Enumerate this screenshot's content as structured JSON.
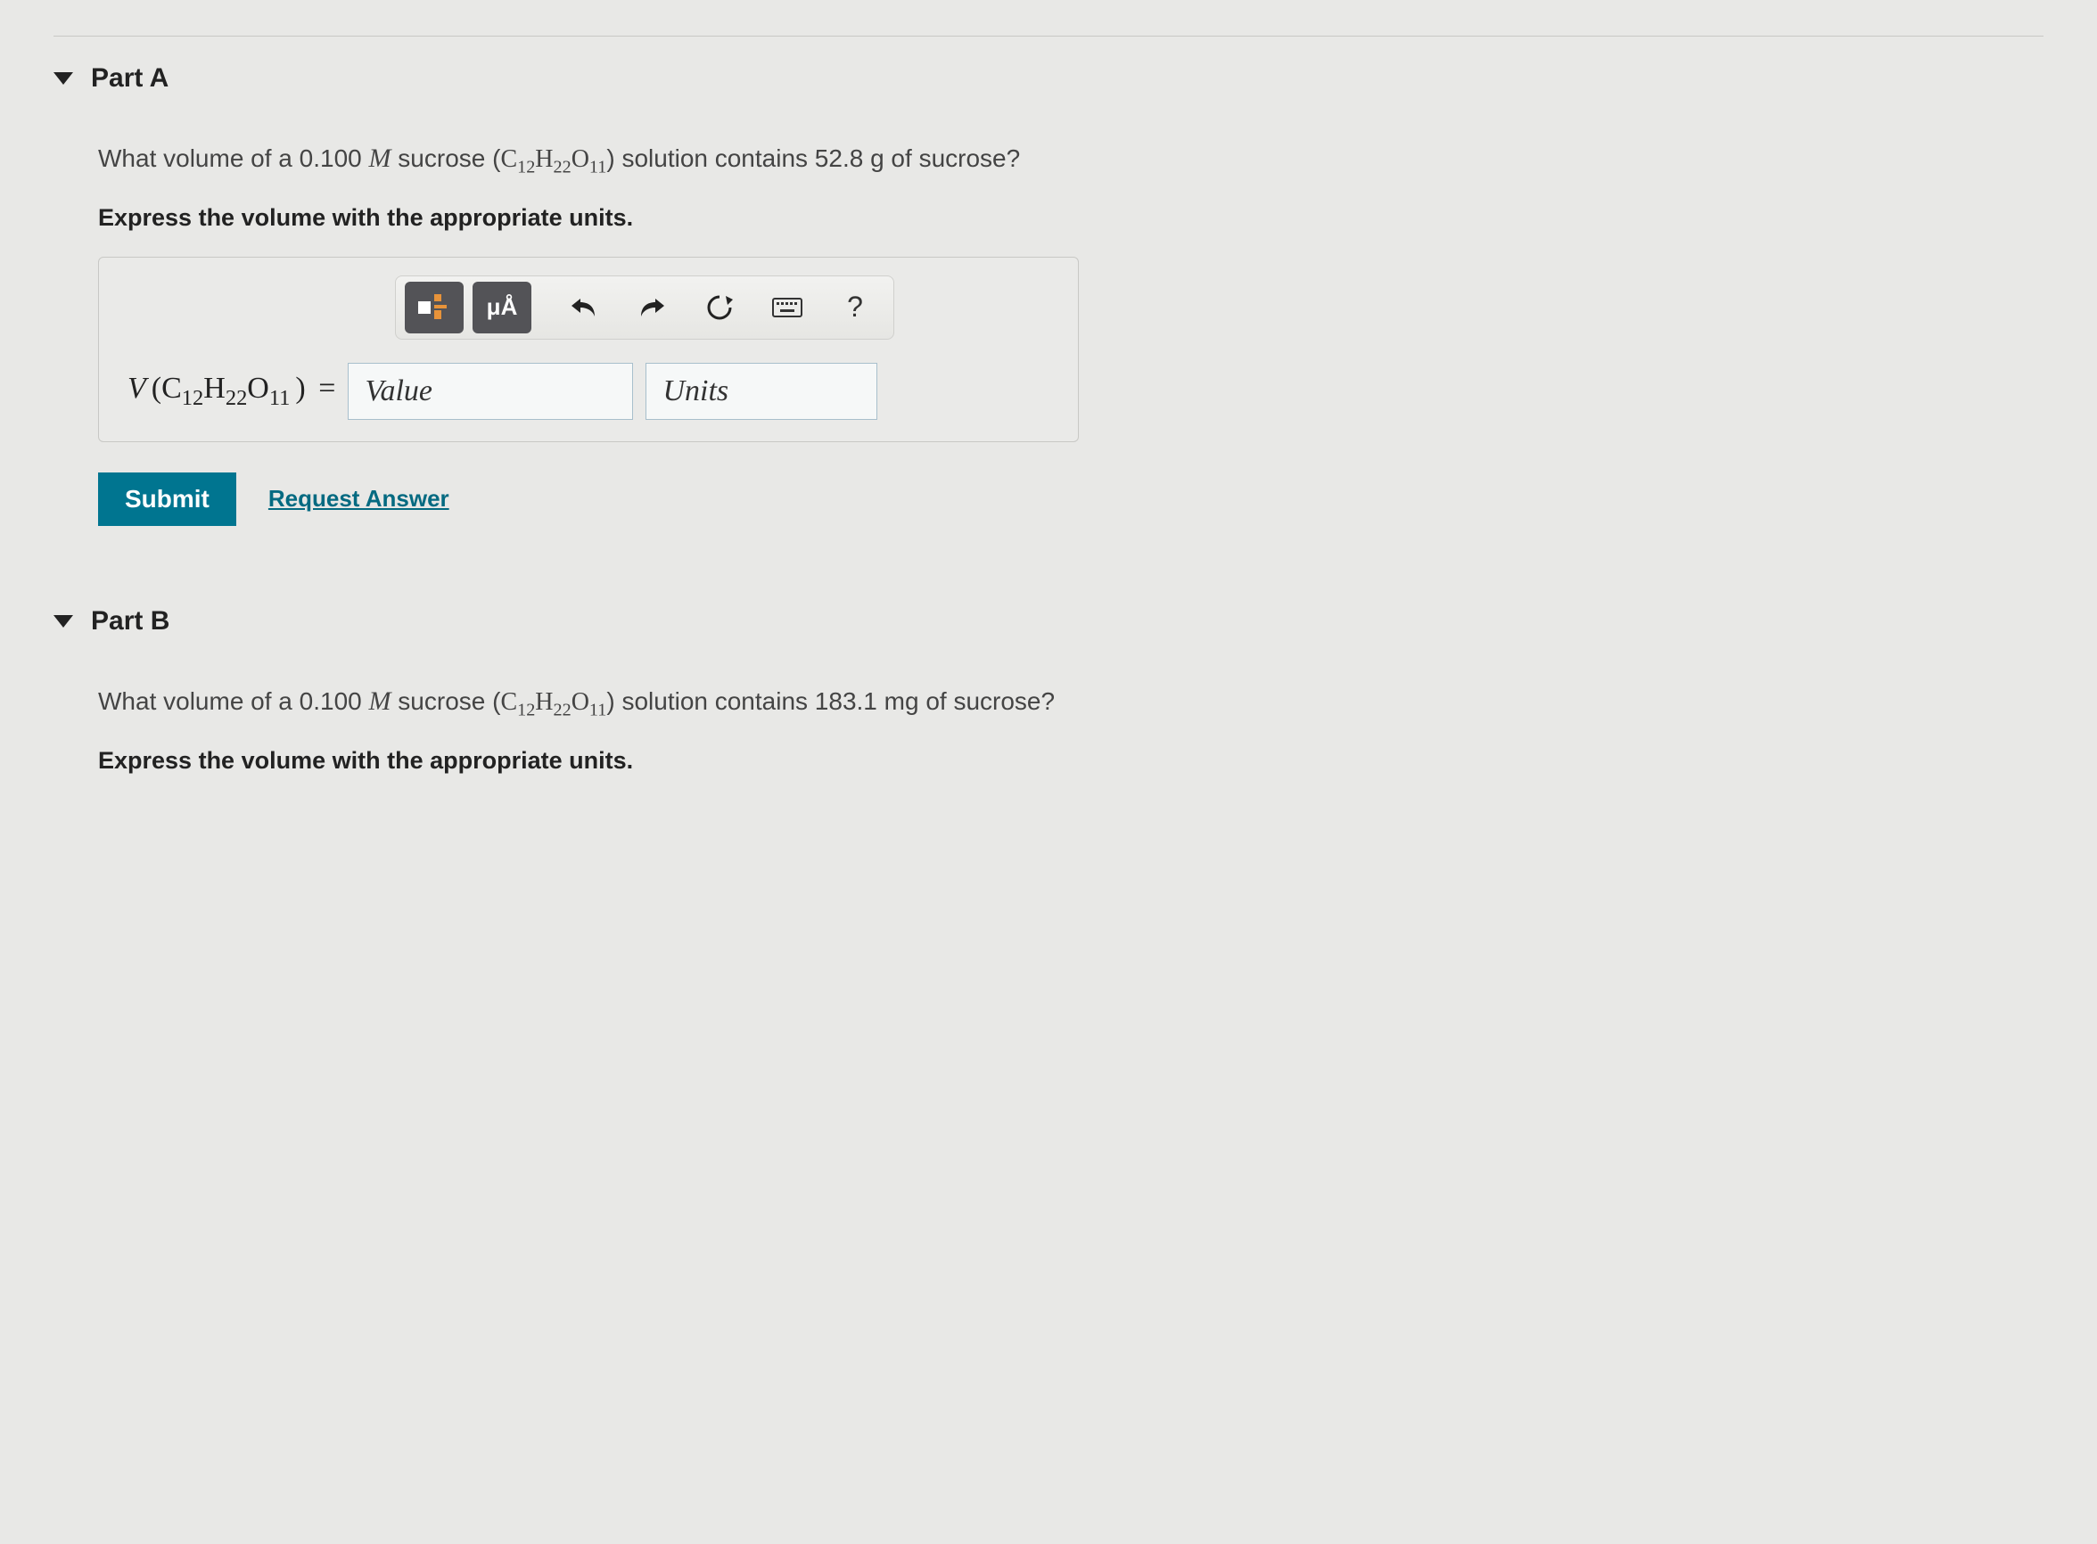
{
  "partA": {
    "title": "Part A",
    "question_pre": "What volume of a 0.100 ",
    "molarity_symbol": "M",
    "question_mid": " sucrose (",
    "formula_c": "C",
    "formula_c_sub": "12",
    "formula_h": "H",
    "formula_h_sub": "22",
    "formula_o": "O",
    "formula_o_sub": "11",
    "question_post": ") solution contains 52.8 g of sucrose?",
    "instruction": "Express the volume with the appropriate units.",
    "expression_v": "V",
    "expression_open": "(",
    "expression_close": ")",
    "equals": " =",
    "value_placeholder": "Value",
    "units_placeholder": "Units",
    "submit_label": "Submit",
    "request_answer_label": "Request Answer",
    "tool_units_label": "μÅ",
    "tool_help_label": "?"
  },
  "partB": {
    "title": "Part B",
    "question_pre": "What volume of a 0.100 ",
    "molarity_symbol": "M",
    "question_mid": " sucrose (",
    "formula_c": "C",
    "formula_c_sub": "12",
    "formula_h": "H",
    "formula_h_sub": "22",
    "formula_o": "O",
    "formula_o_sub": "11",
    "question_post": ") solution contains 183.1 mg of sucrose?",
    "instruction": "Express the volume with the appropriate units."
  }
}
